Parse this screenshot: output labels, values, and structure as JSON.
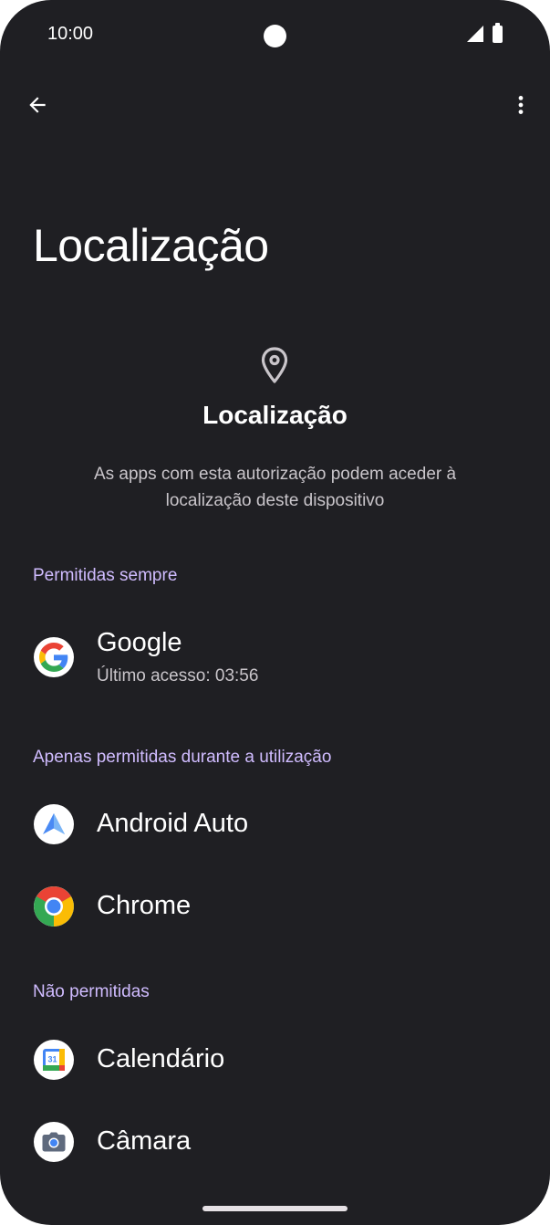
{
  "status_bar": {
    "time": "10:00"
  },
  "toolbar": {
    "back_icon": "arrow-back-icon",
    "more_icon": "more-vert-icon"
  },
  "page": {
    "title": "Localização"
  },
  "header": {
    "icon": "location-pin-icon",
    "title": "Localização",
    "description": "As apps com esta autorização podem aceder à localização deste dispositivo"
  },
  "sections": {
    "always": {
      "label": "Permitidas sempre",
      "apps": [
        {
          "name": "Google",
          "subtitle": "Último acesso: 03:56",
          "icon": "google-app-icon"
        }
      ]
    },
    "while_in_use": {
      "label": "Apenas permitidas durante a utilização",
      "apps": [
        {
          "name": "Android Auto",
          "icon": "android-auto-app-icon"
        },
        {
          "name": "Chrome",
          "icon": "chrome-app-icon"
        }
      ]
    },
    "not_allowed": {
      "label": "Não permitidas",
      "apps": [
        {
          "name": "Calendário",
          "icon": "calendar-app-icon",
          "icon_text": "31"
        },
        {
          "name": "Câmara",
          "icon": "camera-app-icon"
        }
      ]
    }
  },
  "colors": {
    "background": "#1f1f23",
    "section_header": "#d0bcff",
    "primary_text": "#ffffff",
    "secondary_text": "#c9c5ca"
  }
}
